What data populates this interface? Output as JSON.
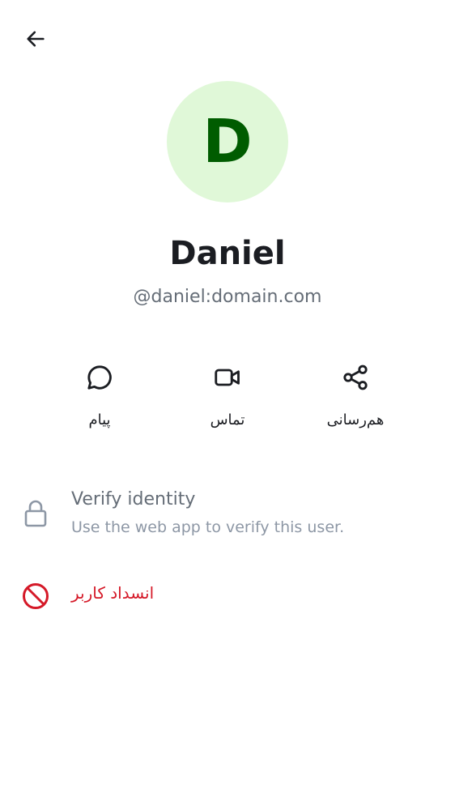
{
  "header": {
    "back_icon": "arrow-left-icon"
  },
  "profile": {
    "avatar_initial": "D",
    "avatar_bg": "#e0f8d8",
    "avatar_fg": "#005c00",
    "display_name": "Daniel",
    "user_id": "@daniel:domain.com"
  },
  "actions": [
    {
      "label": "پیام",
      "icon": "chat-bubble-icon"
    },
    {
      "label": "تماس",
      "icon": "video-camera-icon"
    },
    {
      "label": "هم‌رسانی",
      "icon": "share-icon"
    }
  ],
  "verify": {
    "icon": "lock-icon",
    "title": "Verify identity",
    "subtitle": "Use the web app to verify this user."
  },
  "block": {
    "icon": "block-icon",
    "label": "انسداد کاربر",
    "color": "#d51928"
  }
}
